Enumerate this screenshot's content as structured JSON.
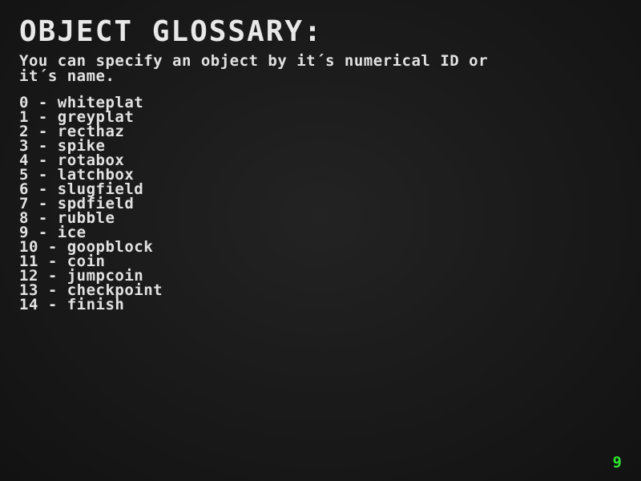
{
  "screen": {
    "title": "OBJECT GLOSSARY:",
    "intro": "You can specify an object by it´s numerical ID or\nit´s name.",
    "page_number": "9",
    "accent_color": "#2ee82e"
  },
  "objects": [
    {
      "id": "0",
      "name": "whiteplat"
    },
    {
      "id": "1",
      "name": "greyplat"
    },
    {
      "id": "2",
      "name": "recthaz"
    },
    {
      "id": "3",
      "name": "spike"
    },
    {
      "id": "4",
      "name": "rotabox"
    },
    {
      "id": "5",
      "name": "latchbox"
    },
    {
      "id": "6",
      "name": "slugfield"
    },
    {
      "id": "7",
      "name": "spdfield"
    },
    {
      "id": "8",
      "name": "rubble"
    },
    {
      "id": "9",
      "name": "ice"
    },
    {
      "id": "10",
      "name": "goopblock"
    },
    {
      "id": "11",
      "name": "coin"
    },
    {
      "id": "12",
      "name": "jumpcoin"
    },
    {
      "id": "13",
      "name": "checkpoint"
    },
    {
      "id": "14",
      "name": "finish"
    }
  ]
}
